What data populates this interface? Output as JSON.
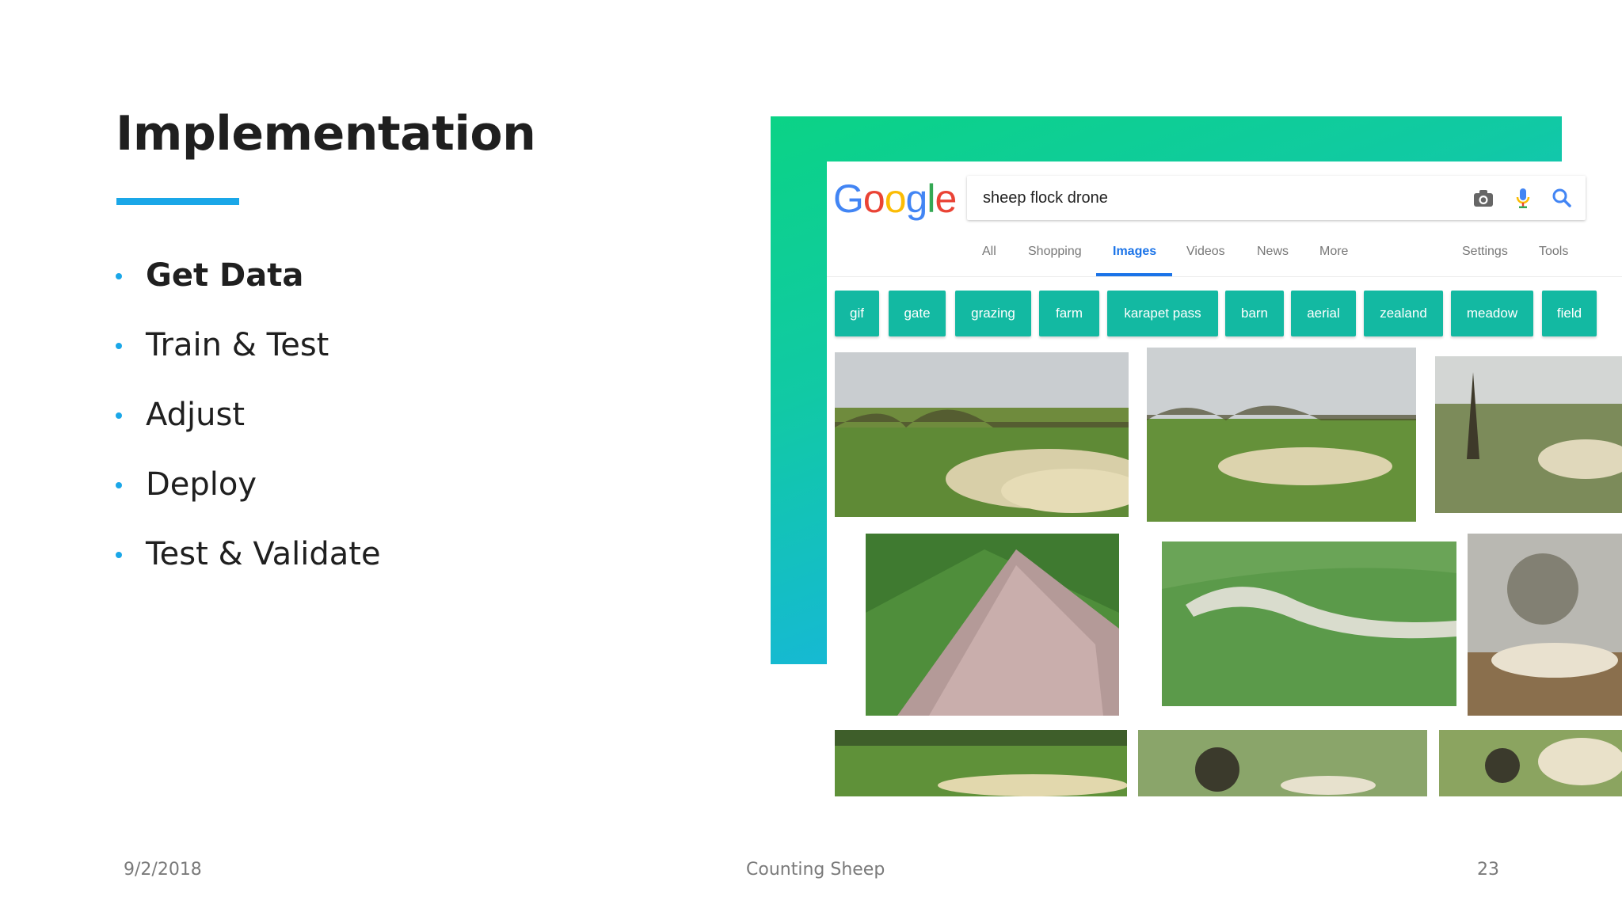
{
  "slide": {
    "title": "Implementation",
    "bullets": [
      "Get Data",
      "Train & Test",
      "Adjust",
      "Deploy",
      "Test & Validate"
    ],
    "accent_color": "#1aa7e8",
    "footer": {
      "date": "9/2/2018",
      "center": "Counting Sheep",
      "page": "23"
    }
  },
  "screenshot": {
    "logo": [
      "G",
      "o",
      "o",
      "g",
      "l",
      "e"
    ],
    "search": {
      "query": "sheep flock drone"
    },
    "icons": [
      "camera-icon",
      "microphone-icon",
      "search-icon"
    ],
    "tabs": [
      "All",
      "Shopping",
      "Images",
      "Videos",
      "News",
      "More"
    ],
    "active_tab": "Images",
    "right_tabs": [
      "Settings",
      "Tools"
    ],
    "chips": [
      "gif",
      "gate",
      "grazing",
      "farm",
      "karapet pass",
      "barn",
      "aerial",
      "zealand",
      "meadow",
      "field"
    ],
    "chip_color": "#13b9a2"
  }
}
